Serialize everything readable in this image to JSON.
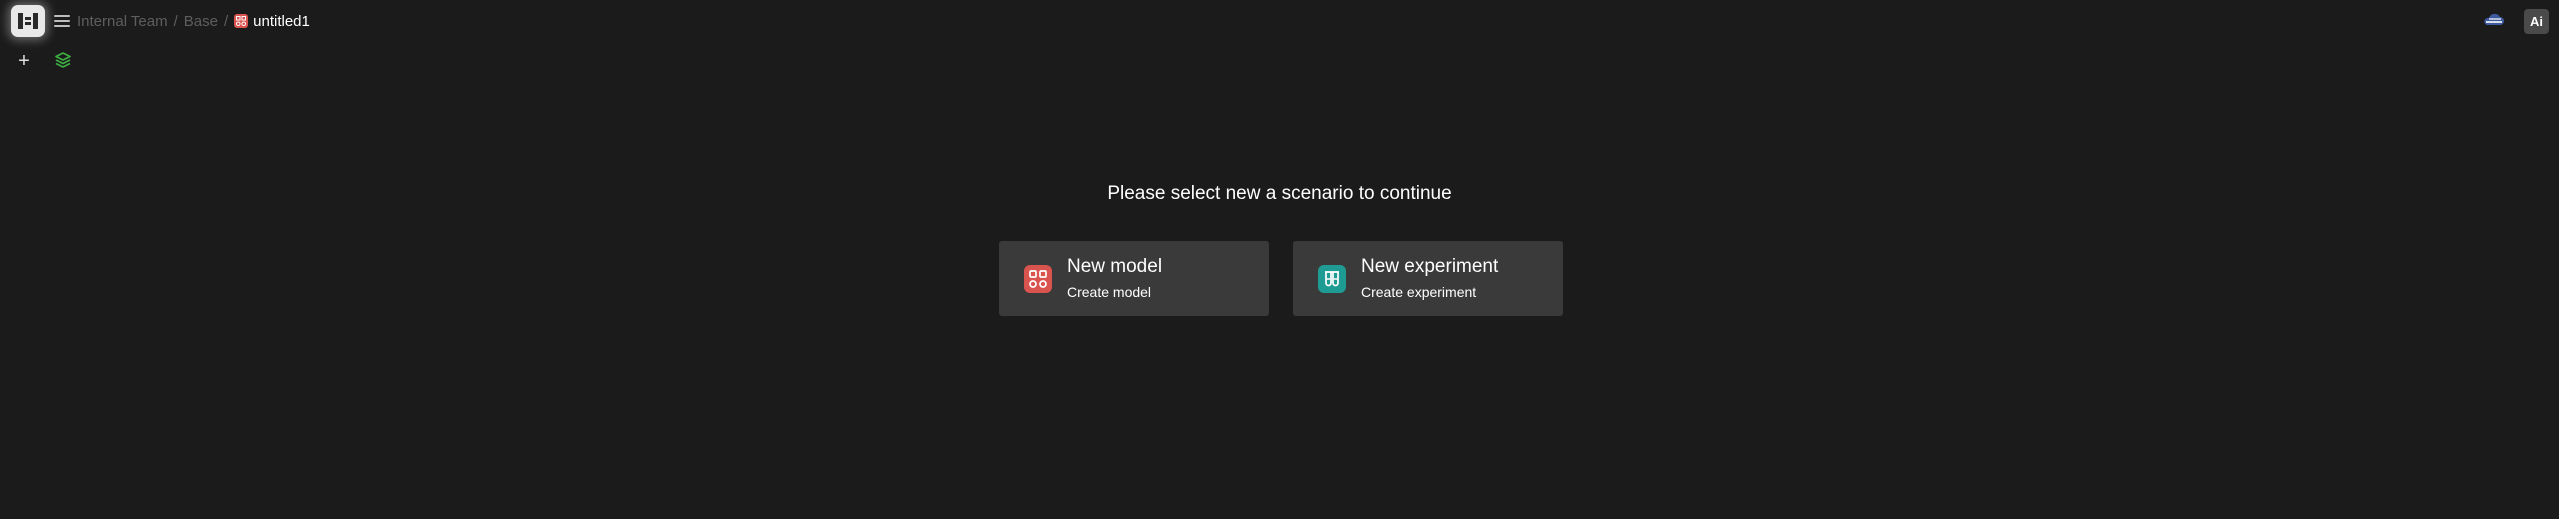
{
  "header": {
    "breadcrumb": {
      "team": "Internal Team",
      "separator": "/",
      "project": "Base",
      "file": "untitled1"
    },
    "icons": {
      "logo": "logo-icon",
      "menu": "hamburger-menu-icon",
      "file": "model-file-icon",
      "sync": "cloud-sync-icon",
      "assistant": "ai-assistant-icon"
    },
    "assistant_label": "Ai"
  },
  "toolbar": {
    "add_label": "+",
    "layers_icon": "layers-icon"
  },
  "main": {
    "prompt": "Please select new a scenario to continue",
    "cards": [
      {
        "title": "New model",
        "subtitle": "Create model",
        "icon": "model-grid-icon",
        "color": "#d9534f"
      },
      {
        "title": "New experiment",
        "subtitle": "Create experiment",
        "icon": "test-tubes-icon",
        "color": "#1e9c93"
      }
    ]
  },
  "colors": {
    "background": "#1b1b1b",
    "card": "#3a3a3a",
    "muted_text": "#5e5e5e",
    "accent_green": "#3cb043"
  }
}
